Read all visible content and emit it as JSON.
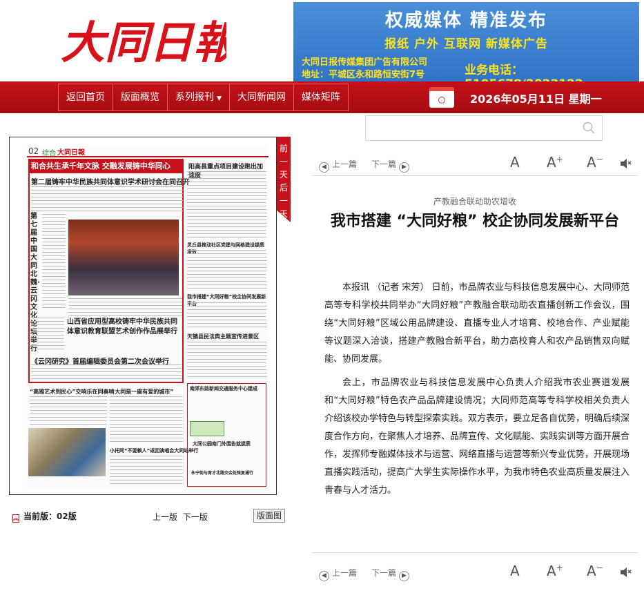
{
  "header": {
    "logo_text": "大同日報",
    "banner": {
      "headline": "权威媒体  精准发布",
      "services": "报纸  户外  互联网  新媒体广告",
      "company": "大同日报传媒集团广告有限公司",
      "address": "地址：平城区永和路恒安街7号",
      "phone": "业务电话：5105678/2023122"
    }
  },
  "nav": {
    "items": [
      {
        "label": "返回首页"
      },
      {
        "label": "版面概览"
      },
      {
        "label": "系列报刊"
      },
      {
        "label": "大同新闻网"
      },
      {
        "label": "媒体矩阵"
      }
    ],
    "date": "2026年05月11日  星期一"
  },
  "search": {
    "placeholder": ""
  },
  "paper": {
    "page_number": "02",
    "section": "综合",
    "masthead": "大同日報",
    "red_title": "和合共生承千年文脉  交融发展铸中华同心",
    "headline_main": "第二届铸牢中华民族共同体意识学术研讨会在同召开",
    "vertical_title": "第七届中国大同北魏·云冈文化论坛举行",
    "sub_headline_2": "山西省应用型高校铸牢中华民族共同体意识教育联盟艺术创作作品展举行",
    "sub_headline_3": "《云冈研究》首届编辑委员会第二次会议举行",
    "col_right_1": "阳高县重点项目建设跑出加速度",
    "col_right_2": "灵丘县推动社区党建与网格建设提质增效",
    "col_right_3": "我市搭建“大同好粮”校企协同发展新平台",
    "col_right_4": "天镇县民法典主题宣传进景区",
    "bottom_1": "“高雅艺术到民心”交响乐在同奏响",
    "bottom_2": "“大同是一座有爱的城市”",
    "bottom_3": "小托阿“不耍赖人”返回演唱会大同站举行",
    "right_box_1": "南郊东路新闻交通服务中心建成",
    "right_box_2": "大同公园南门外围告就提质",
    "right_box_3": "永宁街与育才北路交会处恢复通行"
  },
  "flip_tab": {
    "chars": [
      "前",
      "一",
      "天",
      "后",
      "一",
      "天"
    ]
  },
  "edition": {
    "current_label": "当前版：",
    "current_value": "02版",
    "prev": "上一版",
    "next": "下一版",
    "layout_button": "版面图"
  },
  "toolbar": {
    "prev": "上一篇",
    "next": "下一篇",
    "font_a": "A",
    "font_plus": "+",
    "font_minus": "−"
  },
  "article": {
    "subtitle": "产教融合联动助农增收",
    "title": "我市搭建 “大同好粮” 校企协同发展新平台",
    "paragraphs": [
      "本报讯 （记者 宋芳） 日前，市品牌农业与科技信息发展中心、大同师范高等专科学校共同举办“大同好粮”产教融合联动助农直播创新工作会议，围绕“大同好粮”区域公用品牌建设、直播专业人才培育、校地合作、产业赋能等议题深入洽谈，搭建产教融合新平台，助力高校育人和农产品销售双向赋能、协同发展。",
      "会上，市品牌农业与科技信息发展中心负责人介绍我市农业赛道发展和“大同好粮”特色农产品品牌建设情况；大同师范高等专科学校相关负责人介绍该校办学特色与转型探索实践。双方表示，要立足各自优势，明确后续深度合作方向，在聚焦人才培养、品牌宣传、文化赋能、实践实训等方面开展合作，发挥师专融媒体技术与运营、网络直播与运营等新兴专业优势，开展现场直播实践活动，提高广大学生实际操作水平，为我市特色农业高质量发展注入青春与人才活力。"
    ]
  },
  "colors": {
    "brand_red": "#c5121b",
    "banner_blue": "#2f74c8",
    "banner_yellow": "#ffe21a"
  }
}
